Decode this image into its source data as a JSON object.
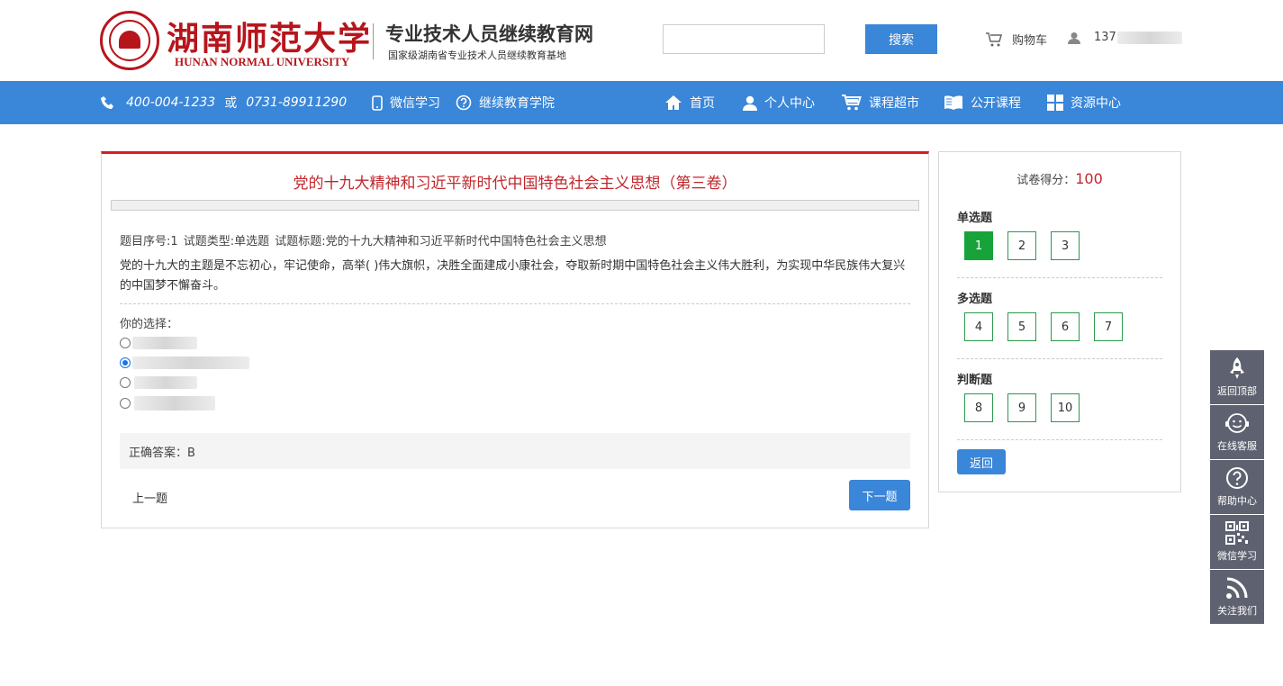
{
  "header": {
    "university_name": "湖南师范大学",
    "university_en": "HUNAN NORMAL UNIVERSITY",
    "site_name": "专业技术人员继续教育网",
    "site_subtitle": "国家级湖南省专业技术人员继续教育基地",
    "search_placeholder": "",
    "search_button": "搜索",
    "cart_label": "购物车",
    "user_prefix": "137"
  },
  "nav": {
    "phone1": "400-004-1233",
    "or": "或",
    "phone2": "0731-89911290",
    "wechat": "微信学习",
    "college": "继续教育学院",
    "home": "首页",
    "personal": "个人中心",
    "market": "课程超市",
    "public": "公开课程",
    "resources": "资源中心"
  },
  "question": {
    "title": "党的十九大精神和习近平新时代中国特色社会主义思想（第三卷）",
    "meta": "题目序号:1    试题类型:单选题  试题标题:党的十九大精神和习近平新时代中国特色社会主义思想",
    "text": "党的十九大的主题是不忘初心，牢记使命，高举( )伟大旗帜，决胜全面建成小康社会，夺取新时期中国特色社会主义伟大胜利，为实现中华民族伟大复兴的中国梦不懈奋斗。",
    "choice_label": "你的选择：",
    "selected_option_index": 1,
    "answer": "正确答案：B",
    "prev": "上一题",
    "next": "下一题"
  },
  "side": {
    "score_label": "试卷得分：",
    "score_value": "100",
    "single_title": "单选题",
    "multi_title": "多选题",
    "judge_title": "判断题",
    "single": [
      "1",
      "2",
      "3"
    ],
    "multi": [
      "4",
      "5",
      "6",
      "7"
    ],
    "judge": [
      "8",
      "9",
      "10"
    ],
    "back": "返回"
  },
  "float": {
    "top": "返回顶部",
    "service": "在线客服",
    "help": "帮助中心",
    "wechat": "微信学习",
    "follow": "关注我们"
  },
  "colors": {
    "brand_red": "#b7151c",
    "nav_blue": "#3a86d8",
    "active_green": "#18a33a"
  }
}
